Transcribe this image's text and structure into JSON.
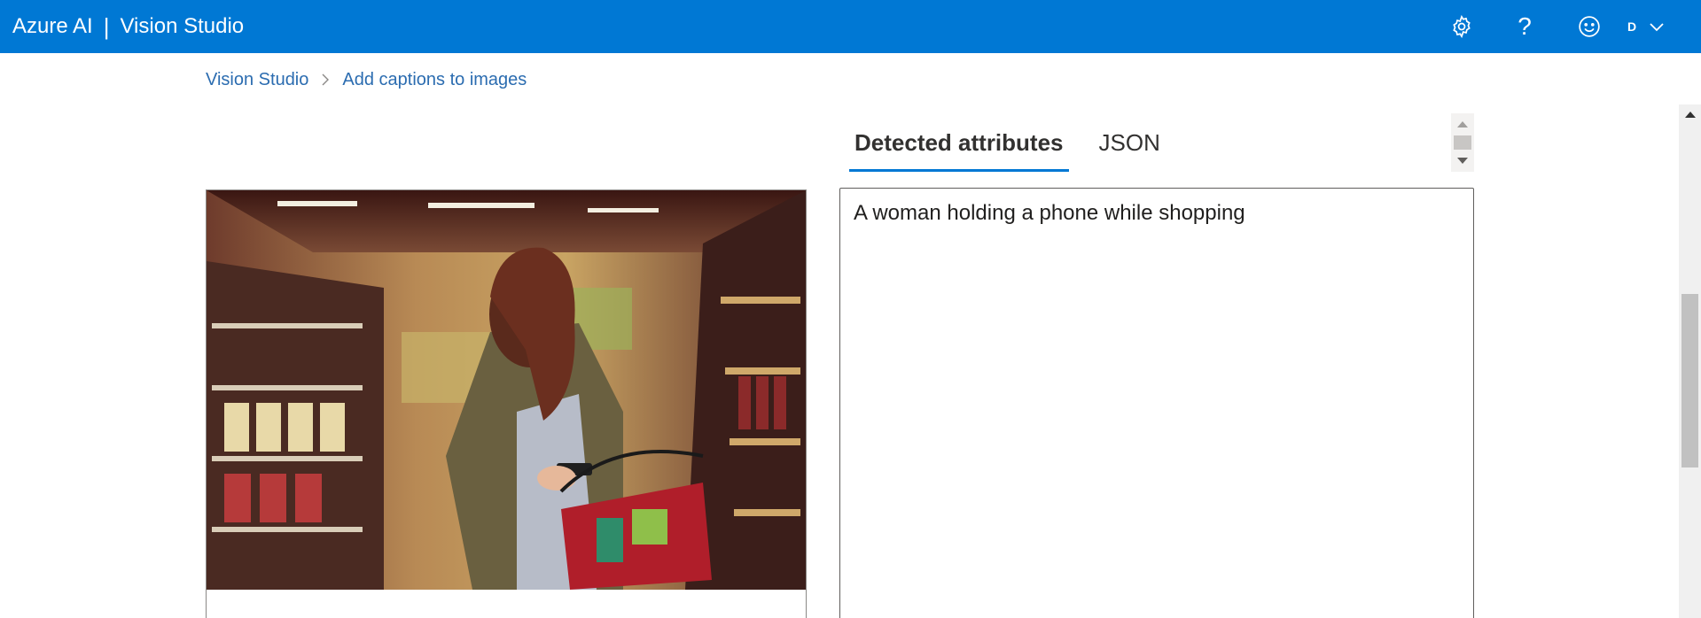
{
  "header": {
    "brand": "Azure AI",
    "separator": "|",
    "product": "Vision Studio",
    "account_initial": "D",
    "icons": [
      "gear-icon",
      "help-icon",
      "smiley-icon",
      "chevron-down-icon"
    ],
    "help_glyph": "?"
  },
  "breadcrumb": {
    "items": [
      {
        "label": "Vision Studio"
      },
      {
        "label": "Add captions to images"
      }
    ],
    "separator_icon": "chevron-right-icon"
  },
  "tabs": [
    {
      "label": "Detected attributes",
      "active": true
    },
    {
      "label": "JSON",
      "active": false
    }
  ],
  "result": {
    "caption": "A woman holding a phone while shopping"
  },
  "image": {
    "subject": "sample-photo"
  },
  "colors": {
    "header_bg": "#0078d4",
    "link": "#2b6cb0",
    "tab_underline": "#0078d4"
  }
}
